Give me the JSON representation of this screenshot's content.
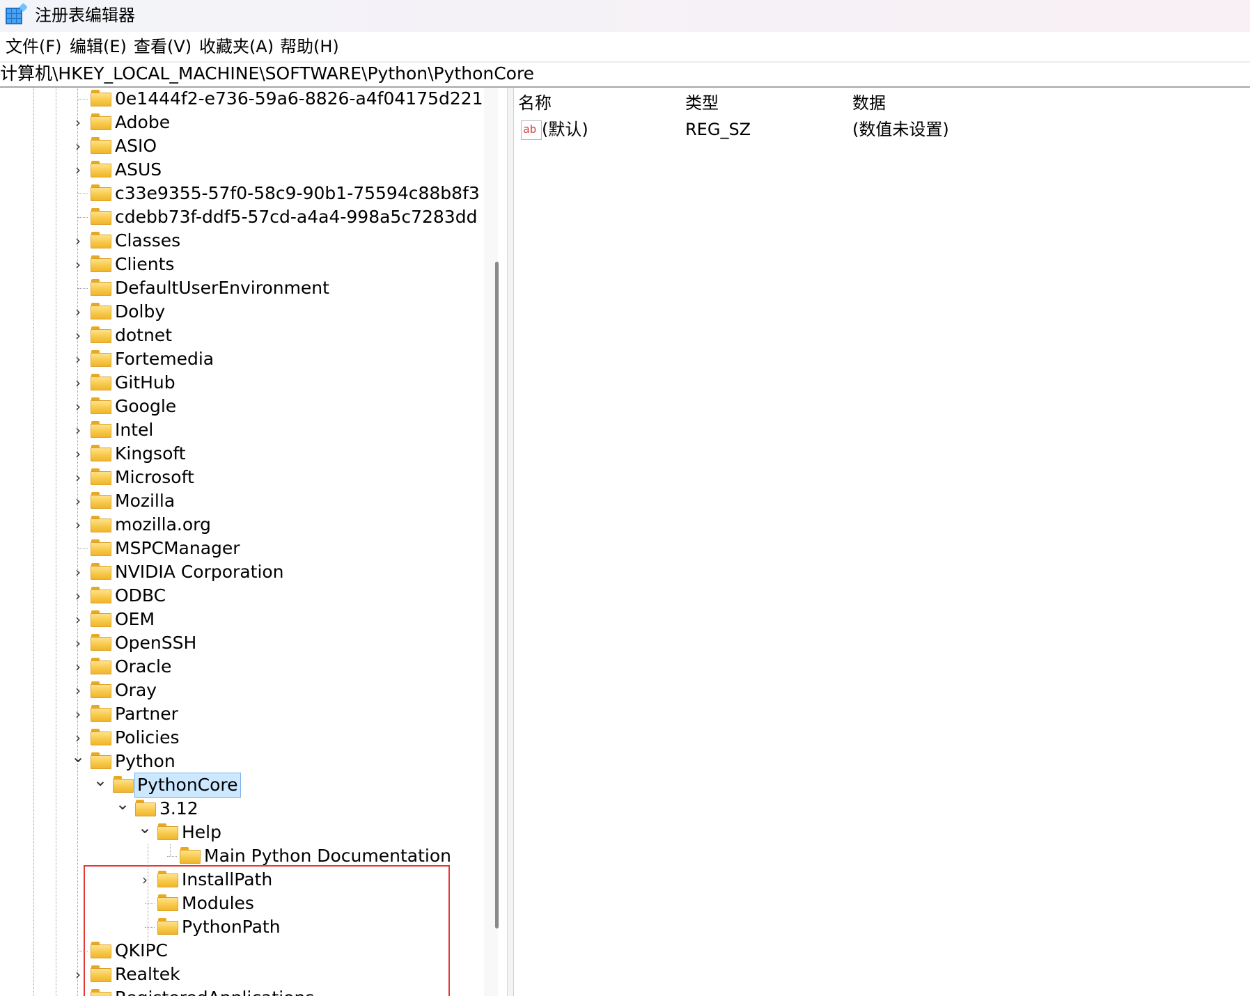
{
  "window": {
    "title": "注册表编辑器",
    "icon": "registry-editor-icon"
  },
  "menu": [
    {
      "label": "文件(F)",
      "key": "F"
    },
    {
      "label": "编辑(E)",
      "key": "E"
    },
    {
      "label": "查看(V)",
      "key": "V"
    },
    {
      "label": "收藏夹(A)",
      "key": "A"
    },
    {
      "label": "帮助(H)",
      "key": "H"
    }
  ],
  "address": "计算机\\HKEY_LOCAL_MACHINE\\SOFTWARE\\Python\\PythonCore",
  "tree": [
    {
      "label": "0e1444f2-e736-59a6-8826-a4f04175d221",
      "depth": 0,
      "expander": "none"
    },
    {
      "label": "Adobe",
      "depth": 0,
      "expander": "collapsed"
    },
    {
      "label": "ASIO",
      "depth": 0,
      "expander": "collapsed"
    },
    {
      "label": "ASUS",
      "depth": 0,
      "expander": "collapsed"
    },
    {
      "label": "c33e9355-57f0-58c9-90b1-75594c88b8f3",
      "depth": 0,
      "expander": "none"
    },
    {
      "label": "cdebb73f-ddf5-57cd-a4a4-998a5c7283dd",
      "depth": 0,
      "expander": "none"
    },
    {
      "label": "Classes",
      "depth": 0,
      "expander": "collapsed"
    },
    {
      "label": "Clients",
      "depth": 0,
      "expander": "collapsed"
    },
    {
      "label": "DefaultUserEnvironment",
      "depth": 0,
      "expander": "none"
    },
    {
      "label": "Dolby",
      "depth": 0,
      "expander": "collapsed"
    },
    {
      "label": "dotnet",
      "depth": 0,
      "expander": "collapsed"
    },
    {
      "label": "Fortemedia",
      "depth": 0,
      "expander": "collapsed"
    },
    {
      "label": "GitHub",
      "depth": 0,
      "expander": "collapsed"
    },
    {
      "label": "Google",
      "depth": 0,
      "expander": "collapsed"
    },
    {
      "label": "Intel",
      "depth": 0,
      "expander": "collapsed"
    },
    {
      "label": "Kingsoft",
      "depth": 0,
      "expander": "collapsed"
    },
    {
      "label": "Microsoft",
      "depth": 0,
      "expander": "collapsed"
    },
    {
      "label": "Mozilla",
      "depth": 0,
      "expander": "collapsed"
    },
    {
      "label": "mozilla.org",
      "depth": 0,
      "expander": "collapsed"
    },
    {
      "label": "MSPCManager",
      "depth": 0,
      "expander": "none"
    },
    {
      "label": "NVIDIA Corporation",
      "depth": 0,
      "expander": "collapsed"
    },
    {
      "label": "ODBC",
      "depth": 0,
      "expander": "collapsed"
    },
    {
      "label": "OEM",
      "depth": 0,
      "expander": "collapsed"
    },
    {
      "label": "OpenSSH",
      "depth": 0,
      "expander": "collapsed"
    },
    {
      "label": "Oracle",
      "depth": 0,
      "expander": "collapsed"
    },
    {
      "label": "Oray",
      "depth": 0,
      "expander": "collapsed"
    },
    {
      "label": "Partner",
      "depth": 0,
      "expander": "collapsed"
    },
    {
      "label": "Policies",
      "depth": 0,
      "expander": "collapsed"
    },
    {
      "label": "Python",
      "depth": 0,
      "expander": "expanded"
    },
    {
      "label": "PythonCore",
      "depth": 1,
      "expander": "expanded",
      "selected": true
    },
    {
      "label": "3.12",
      "depth": 2,
      "expander": "expanded"
    },
    {
      "label": "Help",
      "depth": 3,
      "expander": "expanded"
    },
    {
      "label": "Main Python Documentation",
      "depth": 4,
      "expander": "none"
    },
    {
      "label": "InstallPath",
      "depth": 3,
      "expander": "collapsed"
    },
    {
      "label": "Modules",
      "depth": 3,
      "expander": "none"
    },
    {
      "label": "PythonPath",
      "depth": 3,
      "expander": "none"
    },
    {
      "label": "QKIPC",
      "depth": 0,
      "expander": "none"
    },
    {
      "label": "Realtek",
      "depth": 0,
      "expander": "collapsed"
    },
    {
      "label": "RegisteredApplications",
      "depth": 0,
      "expander": "none"
    }
  ],
  "list": {
    "columns": [
      "名称",
      "类型",
      "数据"
    ],
    "rows": [
      {
        "icon": "string-value-icon",
        "icon_text": "ab",
        "name": "(默认)",
        "type": "REG_SZ",
        "data": "(数值未设置)"
      }
    ]
  },
  "colors": {
    "selection_bg": "#cce8ff",
    "highlight_border": "#e53935",
    "folder": "#f7c94b"
  }
}
